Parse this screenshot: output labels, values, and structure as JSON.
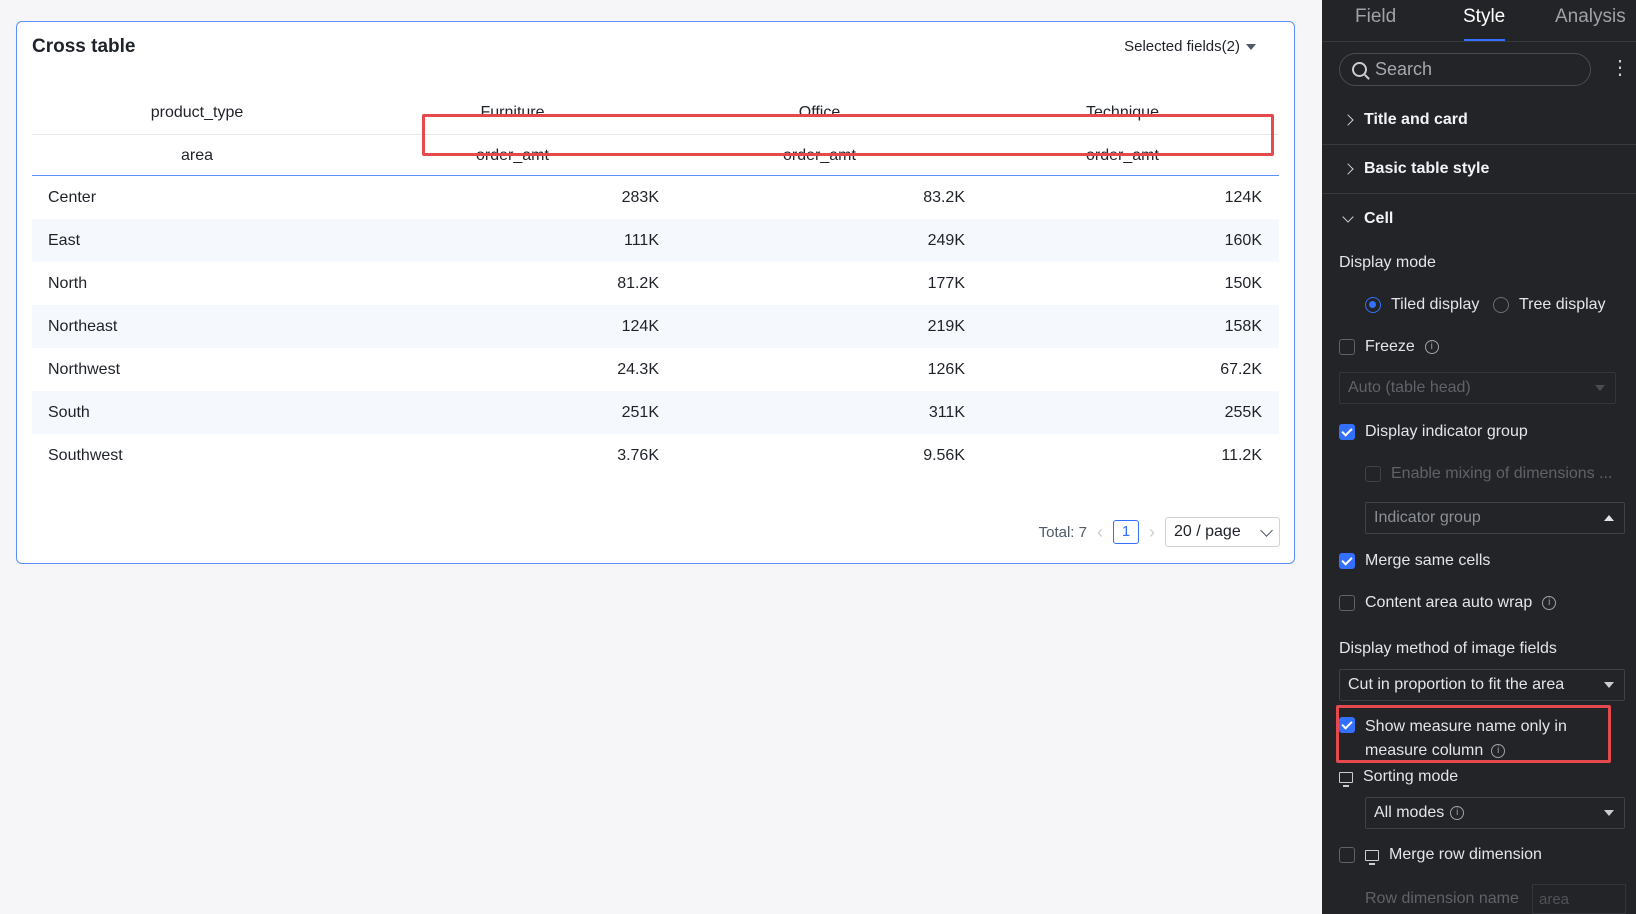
{
  "card": {
    "title": "Cross table",
    "selected_fields": "Selected fields(2)"
  },
  "table": {
    "header_row1": [
      "product_type",
      "Furniture",
      "Office",
      "Technique"
    ],
    "header_row2": [
      "area",
      "order_amt",
      "order_amt",
      "order_amt"
    ],
    "rows": [
      [
        "Center",
        "283K",
        "83.2K",
        "124K"
      ],
      [
        "East",
        "111K",
        "249K",
        "160K"
      ],
      [
        "North",
        "81.2K",
        "177K",
        "150K"
      ],
      [
        "Northeast",
        "124K",
        "219K",
        "158K"
      ],
      [
        "Northwest",
        "24.3K",
        "126K",
        "67.2K"
      ],
      [
        "South",
        "251K",
        "311K",
        "255K"
      ],
      [
        "Southwest",
        "3.76K",
        "9.56K",
        "11.2K"
      ]
    ]
  },
  "pager": {
    "total": "Total: 7",
    "current_page": "1",
    "page_size": "20 / page"
  },
  "panel": {
    "tabs": [
      "Field",
      "Style",
      "Analysis"
    ],
    "active_tab": "Style",
    "search_placeholder": "Search",
    "sections": {
      "title_and_card": "Title and card",
      "basic_table_style": "Basic table style",
      "cell": "Cell"
    },
    "display_mode_label": "Display mode",
    "tiled_display": "Tiled display",
    "tree_display": "Tree display",
    "freeze": "Freeze",
    "freeze_select": "Auto (table head)",
    "display_indicator_group": "Display indicator group",
    "enable_mixing": "Enable mixing of dimensions ...",
    "indicator_group_select": "Indicator group",
    "merge_same_cells": "Merge same cells",
    "content_auto_wrap": "Content area auto wrap",
    "image_fields_label": "Display method of image fields",
    "image_fields_select": "Cut in proportion to fit the area",
    "show_measure_name_line1": "Show measure name only in",
    "show_measure_name_line2": "measure column",
    "sorting_mode": "Sorting mode",
    "sorting_select": "All modes",
    "merge_row_dimension": "Merge row dimension",
    "row_dimension_name": "Row dimension name",
    "row_dimension_value": "area"
  },
  "colors": {
    "accent": "#3370ff",
    "highlight": "#e5484d",
    "panel_bg": "#232427"
  }
}
